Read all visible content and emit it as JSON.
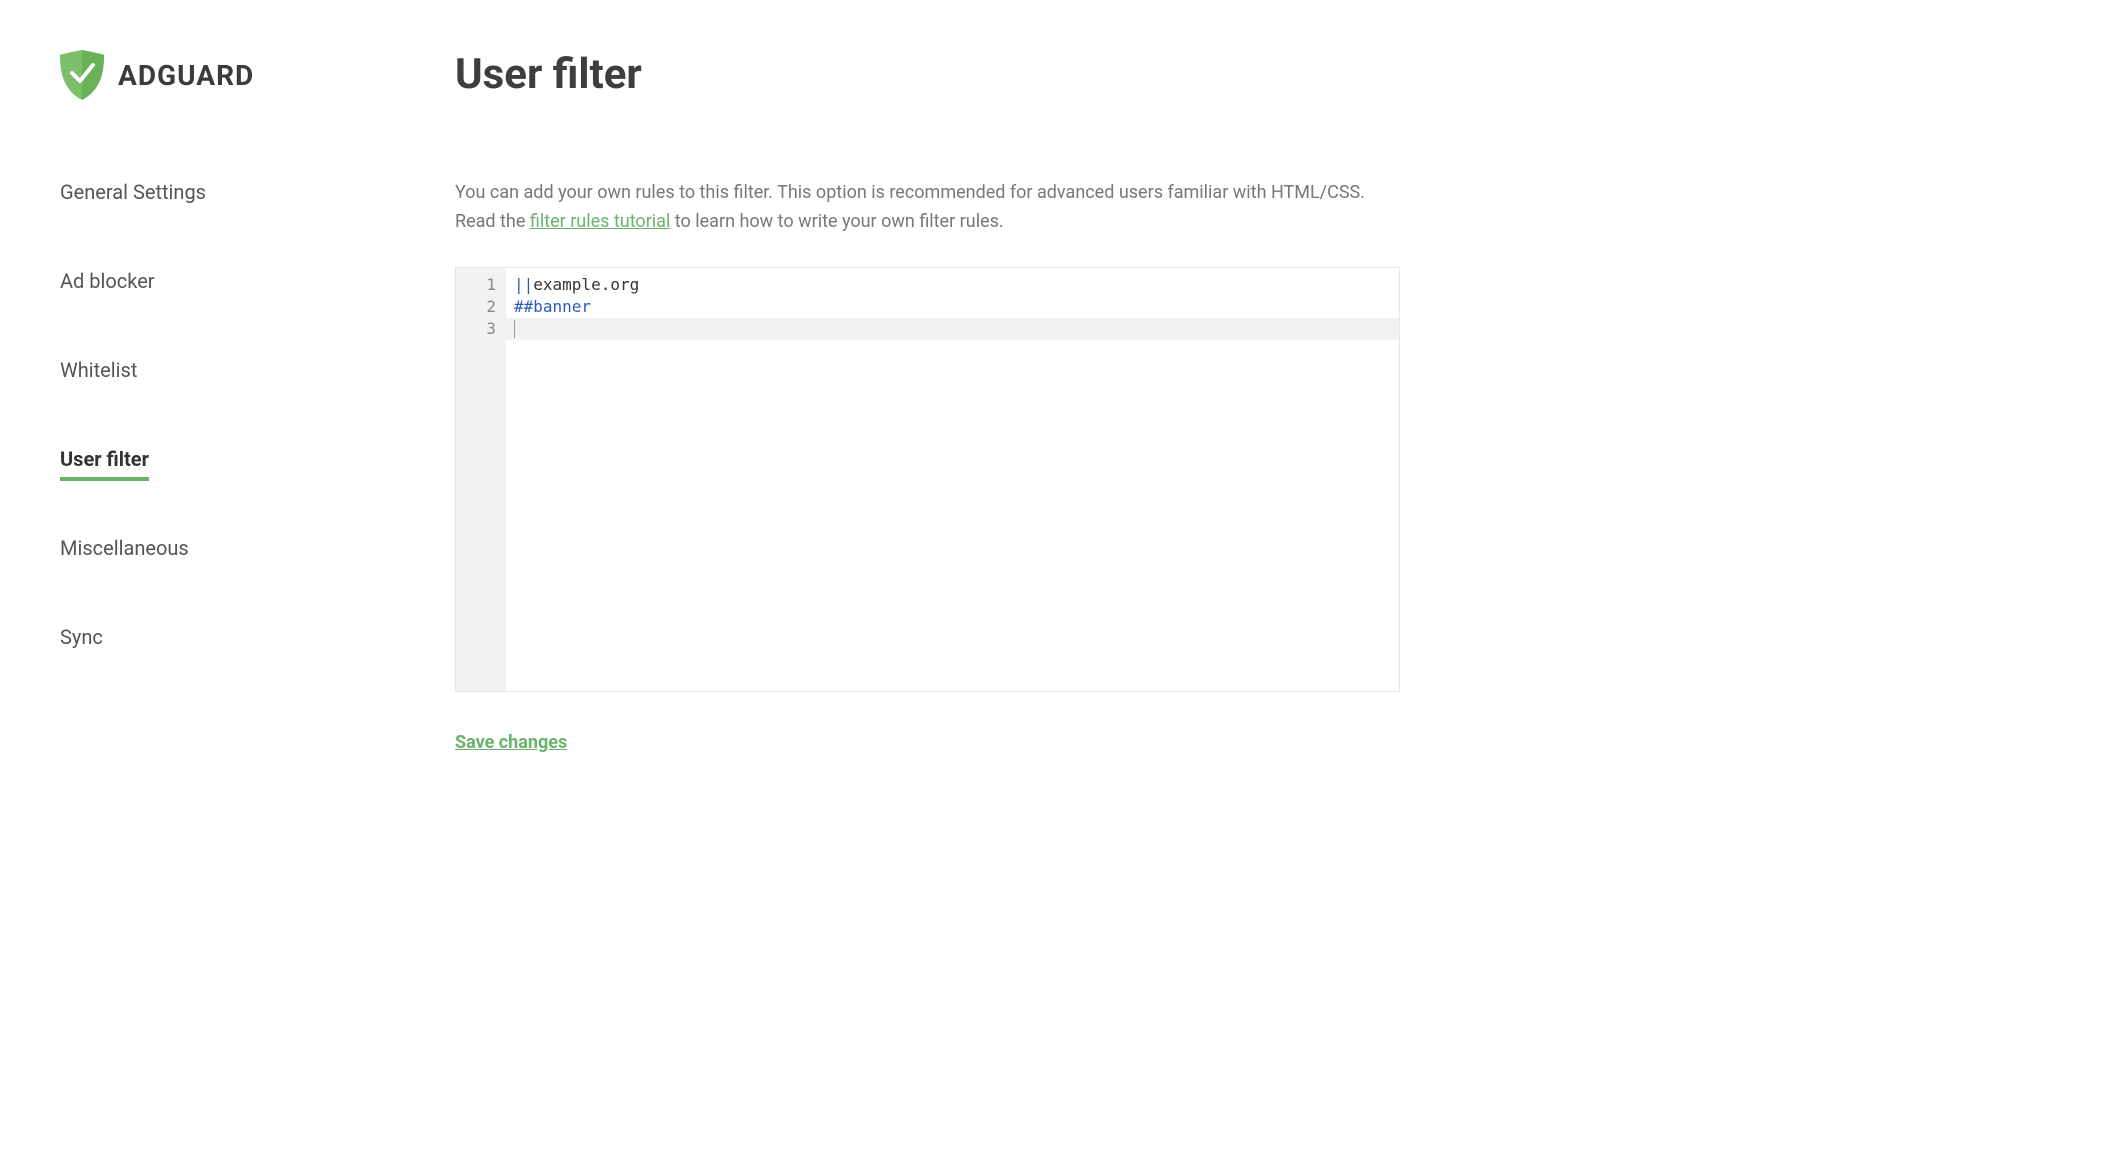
{
  "brand": {
    "name": "ADGUARD"
  },
  "sidebar": {
    "items": [
      {
        "label": "General Settings",
        "active": false
      },
      {
        "label": "Ad blocker",
        "active": false
      },
      {
        "label": "Whitelist",
        "active": false
      },
      {
        "label": "User filter",
        "active": true
      },
      {
        "label": "Miscellaneous",
        "active": false
      },
      {
        "label": "Sync",
        "active": false
      }
    ]
  },
  "main": {
    "title": "User filter",
    "description_pre": "You can add your own rules to this filter. This option is recommended for advanced users familiar with HTML/CSS. Read the ",
    "description_link": "filter rules tutorial",
    "description_post": " to learn how to write your own filter rules."
  },
  "editor": {
    "lines": [
      {
        "n": "1",
        "tokens": [
          {
            "t": "||",
            "c": "keyword"
          },
          {
            "t": "example.org",
            "c": "plain"
          }
        ]
      },
      {
        "n": "2",
        "tokens": [
          {
            "t": "##banner",
            "c": "keyword"
          }
        ]
      },
      {
        "n": "3",
        "tokens": [],
        "active": true
      }
    ]
  },
  "actions": {
    "save": "Save changes"
  }
}
